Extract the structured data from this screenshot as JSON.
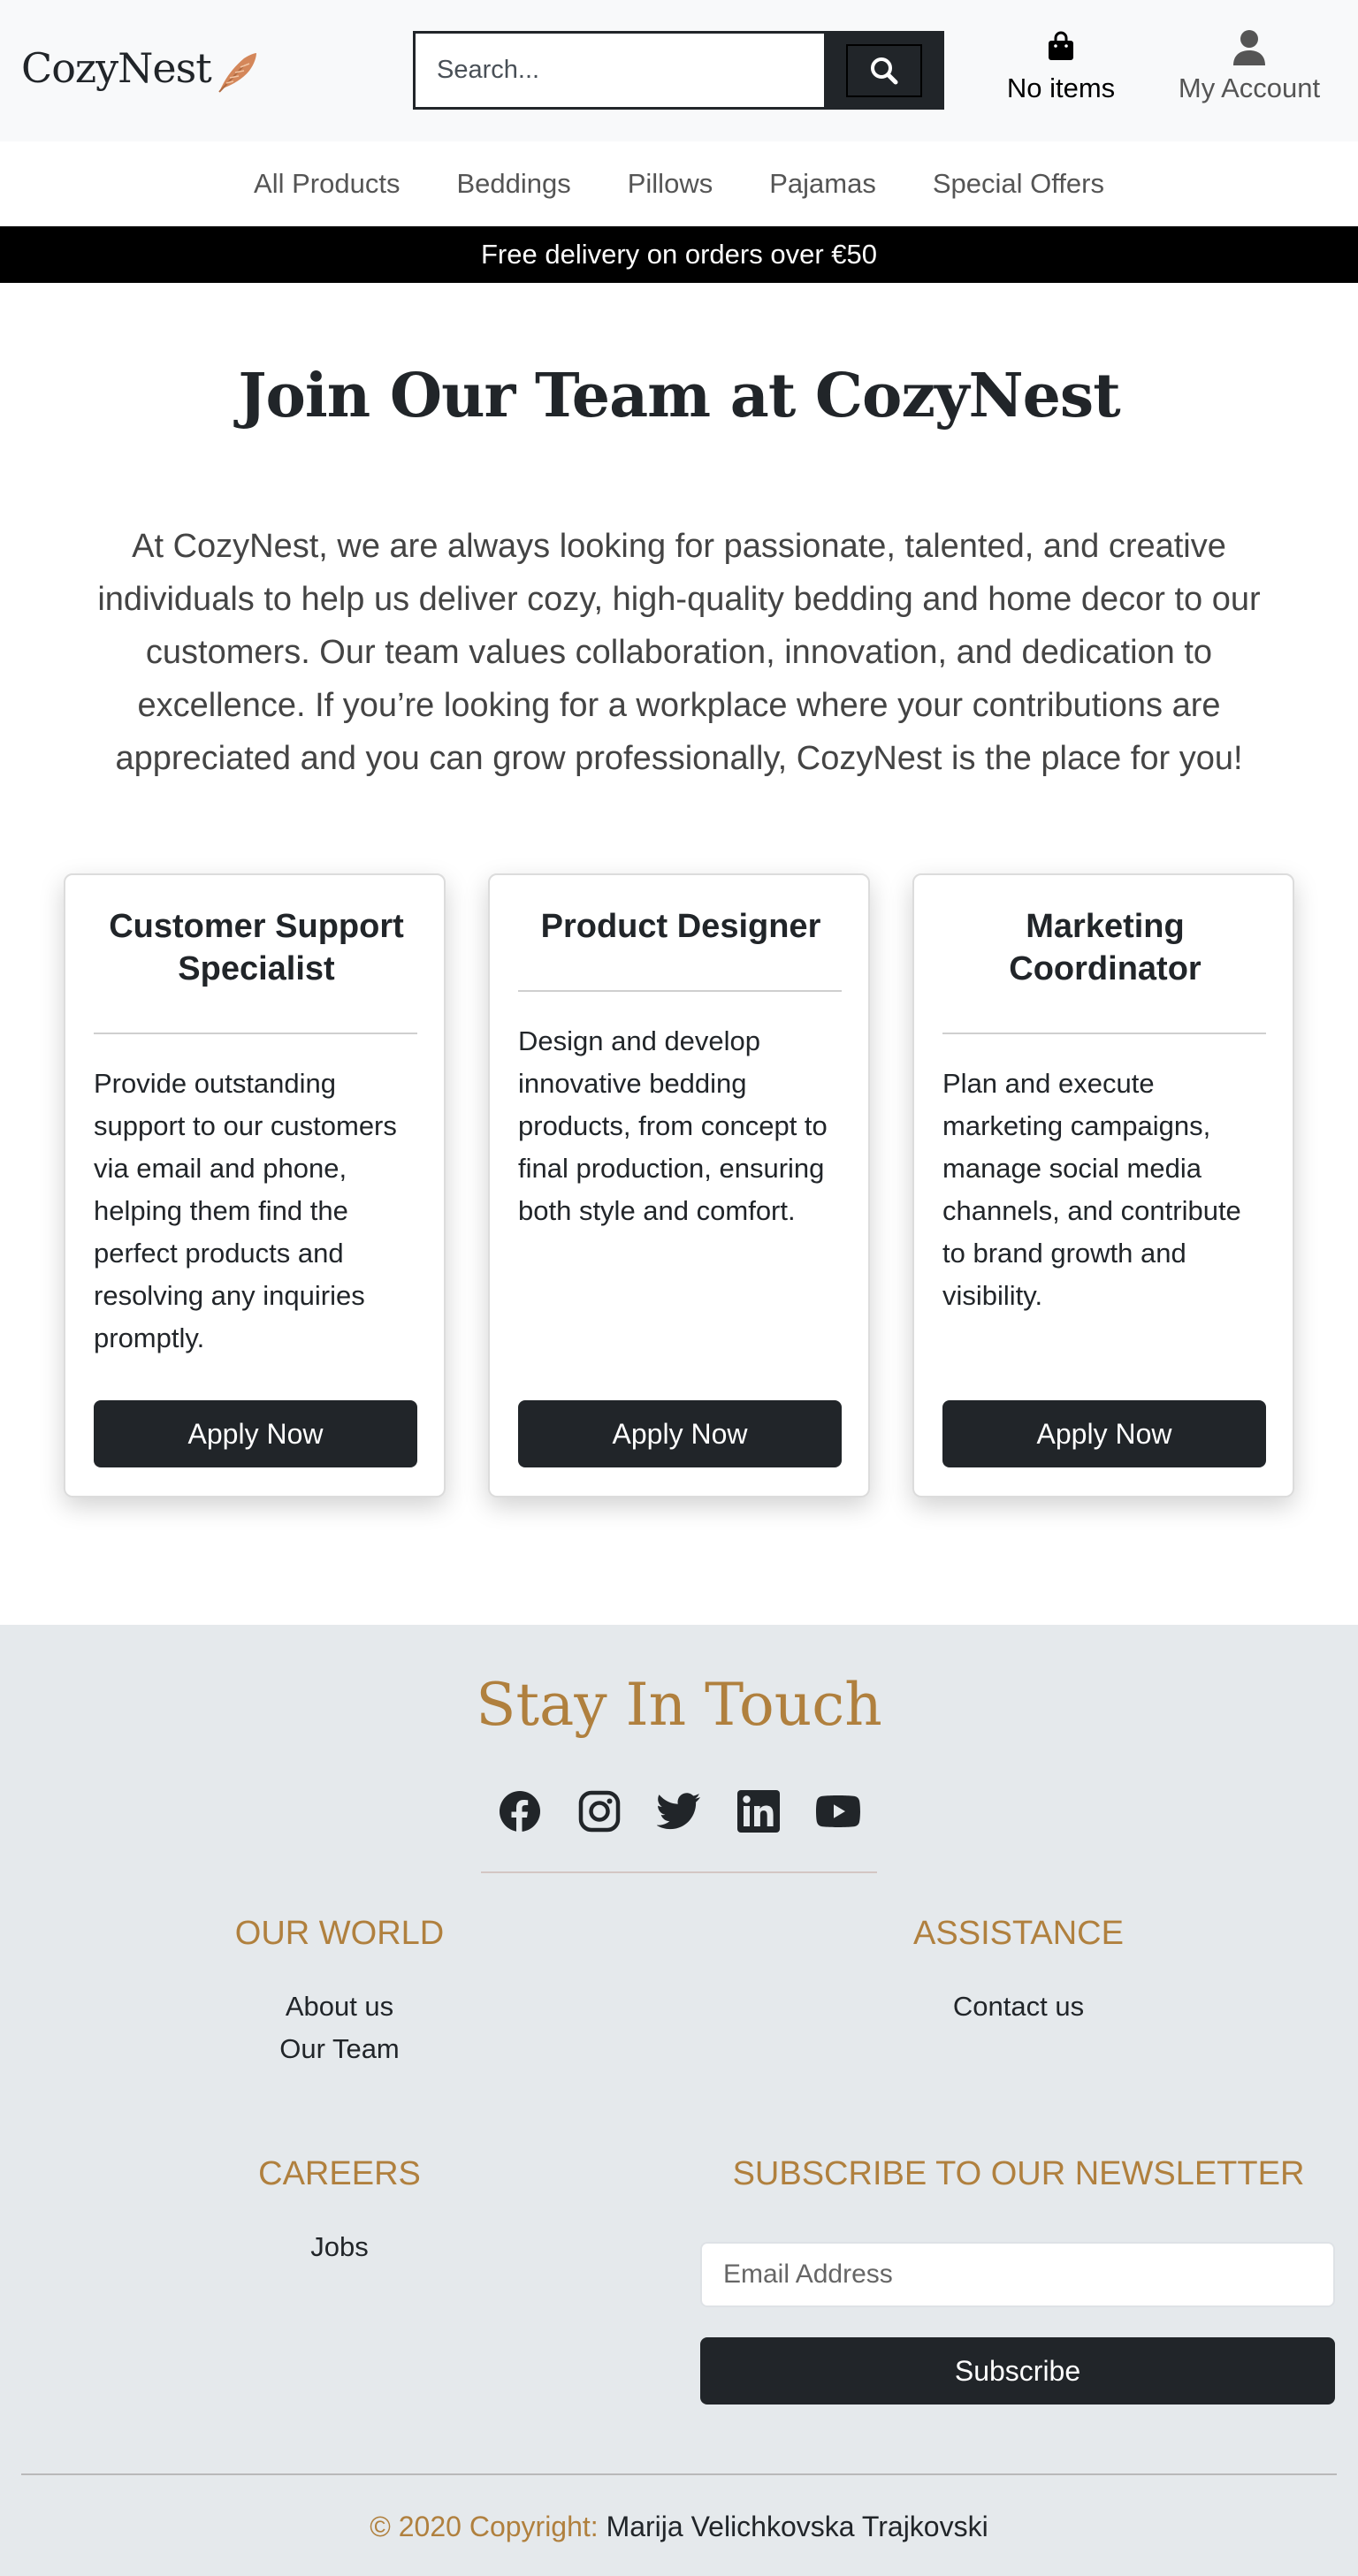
{
  "header": {
    "logo_text": "CozyNest",
    "logo_icon": "feather-icon",
    "search_placeholder": "Search...",
    "search_icon": "search-icon",
    "cart_label": "No items",
    "cart_icon": "shopping-bag-icon",
    "account_label": "My Account",
    "account_icon": "user-icon"
  },
  "nav": {
    "items": [
      "All Products",
      "Beddings",
      "Pillows",
      "Pajamas",
      "Special Offers"
    ]
  },
  "promo": {
    "text": "Free delivery on orders over €50"
  },
  "main": {
    "title": "Join Our Team at CozyNest",
    "intro": "At CozyNest, we are always looking for passionate, talented, and creative individuals to help us deliver cozy, high-quality bedding and home decor to our customers. Our team values collaboration, innovation, and dedication to excellence. If you’re looking for a workplace where your contributions are appreciated and you can grow professionally, CozyNest is the place for you!",
    "jobs": [
      {
        "title": "Customer Support Specialist",
        "description": "Provide outstanding support to our customers via email and phone, helping them find the perfect products and resolving any inquiries promptly.",
        "button": "Apply Now"
      },
      {
        "title": "Product Designer",
        "description": "Design and develop innovative bedding products, from concept to final production, ensuring both style and comfort.",
        "button": "Apply Now"
      },
      {
        "title": "Marketing Coordinator",
        "description": "Plan and execute marketing campaigns, manage social media channels, and contribute to brand growth and visibility.",
        "button": "Apply Now"
      }
    ]
  },
  "footer": {
    "stay_title": "Stay In Touch",
    "socials": [
      "facebook-icon",
      "instagram-icon",
      "twitter-icon",
      "linkedin-icon",
      "youtube-icon"
    ],
    "our_world": {
      "heading": "OUR WORLD",
      "links": [
        "About us",
        "Our Team"
      ]
    },
    "assistance": {
      "heading": "ASSISTANCE",
      "links": [
        "Contact us"
      ]
    },
    "careers": {
      "heading": "CAREERS",
      "links": [
        "Jobs"
      ]
    },
    "newsletter": {
      "heading": "SUBSCRIBE TO OUR NEWSLETTER",
      "email_placeholder": "Email Address",
      "button": "Subscribe"
    },
    "copyright_prefix": "© 2020 Copyright:",
    "copyright_name": "Marija Velichkovska Trajkovski"
  },
  "colors": {
    "accent": "#b0803e",
    "dark": "#212529",
    "footer_bg": "#e5e9ec",
    "header_bg": "#f8f9fa"
  }
}
